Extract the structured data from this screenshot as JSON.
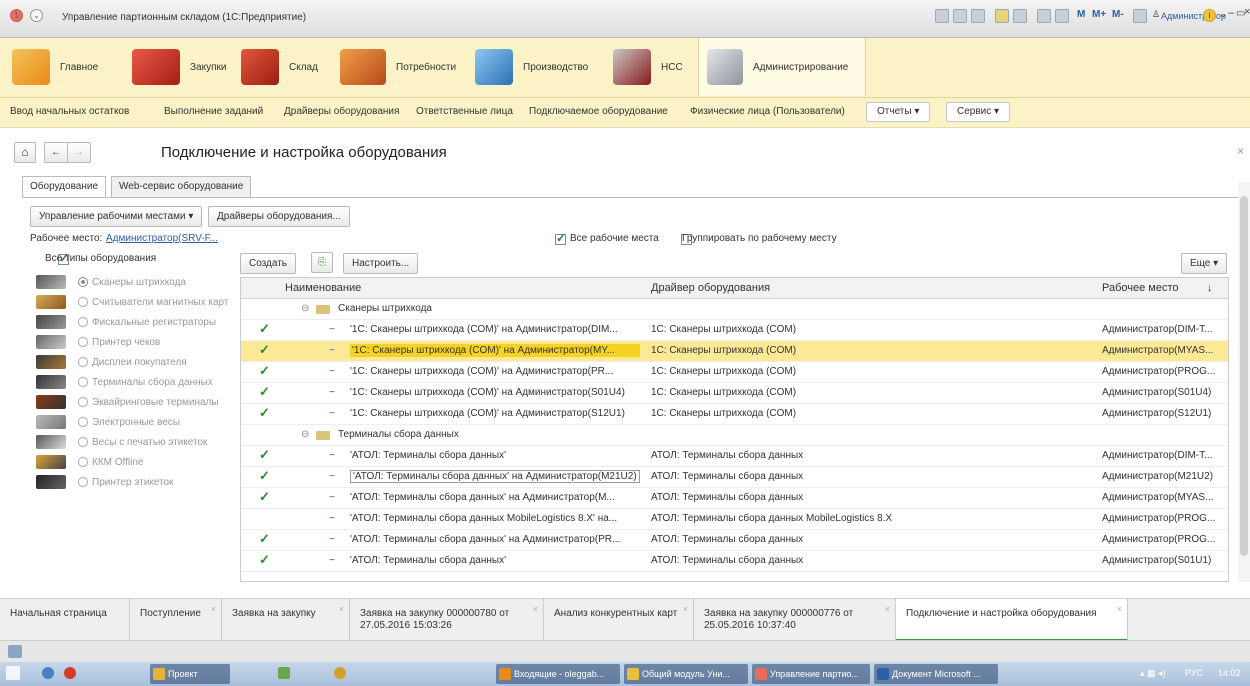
{
  "app": {
    "window_title": "Управление партионным складом (1С:Предприятие)",
    "memory_buttons": [
      "M",
      "M+",
      "M-"
    ],
    "user": "Администратор"
  },
  "sections": [
    {
      "label": "Главное",
      "icon": "home-notes-icon",
      "color": "#e98a1a"
    },
    {
      "label": "Закупки",
      "icon": "truck-icon",
      "color": "#d23a2a"
    },
    {
      "label": "Склад",
      "icon": "boxes-icon",
      "color": "#c4361f"
    },
    {
      "label": "Потребности",
      "icon": "packages-icon",
      "color": "#d8622a"
    },
    {
      "label": "Производство",
      "icon": "factory-icon",
      "color": "#3a7fc4"
    },
    {
      "label": "НСС",
      "icon": "folder-icon",
      "color": "#a52121"
    },
    {
      "label": "Администрирование",
      "icon": "tools-icon",
      "color": "#9aa0a8"
    }
  ],
  "subcommands": [
    "Ввод начальных остатков",
    "Выполнение заданий",
    "Драйверы оборудования",
    "Ответственные лица",
    "Подключаемое оборудование",
    "Физические лица (Пользователи)"
  ],
  "subdropdowns": [
    "Отчеты",
    "Сервис"
  ],
  "page": {
    "title": "Подключение и настройка оборудования"
  },
  "tabs": [
    "Оборудование",
    "Web-сервис оборудование"
  ],
  "toolbar": {
    "workplaces_btn": "Управление рабочими местами",
    "drivers_btn": "Драйверы оборудования...",
    "workplace_label": "Рабочее место:",
    "workplace_value": "Администратор(SRV-F...",
    "all_workplaces": "Все рабочие места",
    "group_by": "Группировать по рабочему месту",
    "all_types": "Все типы оборудования",
    "create": "Создать",
    "configure": "Настроить...",
    "more": "Еще"
  },
  "equipment_types": [
    "Сканеры штрихкода",
    "Считыватели магнитных карт",
    "Фискальные регистраторы",
    "Принтер чеков",
    "Дисплеи покупателя",
    "Терминалы сбора данных",
    "Эквайринговые терминалы",
    "Электронные весы",
    "Весы с печатью этикеток",
    "ККМ Offline",
    "Принтер этикеток"
  ],
  "grid": {
    "headers": [
      "Наименование",
      "Драйвер оборудования",
      "Рабочее место"
    ],
    "rows": [
      {
        "group": "Сканеры штрихкода"
      },
      {
        "check": true,
        "name": "'1С: Сканеры штрихкода (COM)' на Администратор(DIM...",
        "driver": "1С: Сканеры штрихкода (COM)",
        "place": "Администратор(DIM-T..."
      },
      {
        "check": true,
        "name": "'1С: Сканеры штрихкода (COM)' на Администратор(MY...",
        "driver": "1С: Сканеры штрихкода (COM)",
        "place": "Администратор(MYAS...",
        "selected": true
      },
      {
        "check": true,
        "name": "'1С: Сканеры штрихкода (COM)' на Администратор(PR...",
        "driver": "1С: Сканеры штрихкода (COM)",
        "place": "Администратор(PROG..."
      },
      {
        "check": true,
        "name": "'1С: Сканеры штрихкода (COM)' на Администратор(S01U4)",
        "driver": "1С: Сканеры штрихкода (COM)",
        "place": "Администратор(S01U4)"
      },
      {
        "check": true,
        "name": "'1С: Сканеры штрихкода (COM)' на Администратор(S12U1)",
        "driver": "1С: Сканеры штрихкода (COM)",
        "place": "Администратор(S12U1)"
      },
      {
        "group": "Терминалы сбора данных"
      },
      {
        "check": true,
        "name": "'АТОЛ: Терминалы сбора данных'",
        "driver": "АТОЛ: Терминалы сбора данных",
        "place": "Администратор(DIM-T..."
      },
      {
        "check": true,
        "name": "'АТОЛ: Терминалы сбора данных' на Администратор(M21U2)",
        "driver": "АТОЛ: Терминалы сбора данных",
        "place": "Администратор(M21U2)",
        "boxed": true
      },
      {
        "check": true,
        "name": "'АТОЛ: Терминалы сбора данных' на Администратор(M...",
        "driver": "АТОЛ: Терминалы сбора данных",
        "place": "Администратор(MYAS..."
      },
      {
        "check": false,
        "name": "'АТОЛ: Терминалы сбора данных MobileLogistics 8.X' на...",
        "driver": "АТОЛ: Терминалы сбора данных MobileLogistics 8.X",
        "place": "Администратор(PROG..."
      },
      {
        "check": true,
        "name": "'АТОЛ: Терминалы сбора данных' на Администратор(PR...",
        "driver": "АТОЛ: Терминалы сбора данных",
        "place": "Администратор(PROG..."
      },
      {
        "check": true,
        "name": "'АТОЛ: Терминалы сбора данных'",
        "driver": "АТОЛ: Терминалы сбора данных",
        "place": "Администратор(S01U1)"
      }
    ]
  },
  "open_tabs": [
    {
      "label": "Начальная страница"
    },
    {
      "label": "Поступление"
    },
    {
      "label": "Заявка на закупку"
    },
    {
      "label": "Заявка на закупку 000000780 от 27.05.2016 15:03:26"
    },
    {
      "label": "Анализ конкурентных карт"
    },
    {
      "label": "Заявка на закупку 000000776 от 25.05.2016 10:37:40"
    },
    {
      "label": "Подключение и настройка оборудования",
      "active": true
    }
  ],
  "taskbar": {
    "items": [
      "Проект",
      "Входящие - oleggab...",
      "Общий модуль Уни...",
      "Управление партио...",
      "Документ Microsoft ..."
    ],
    "lang": "РУС",
    "time": "14:02"
  }
}
